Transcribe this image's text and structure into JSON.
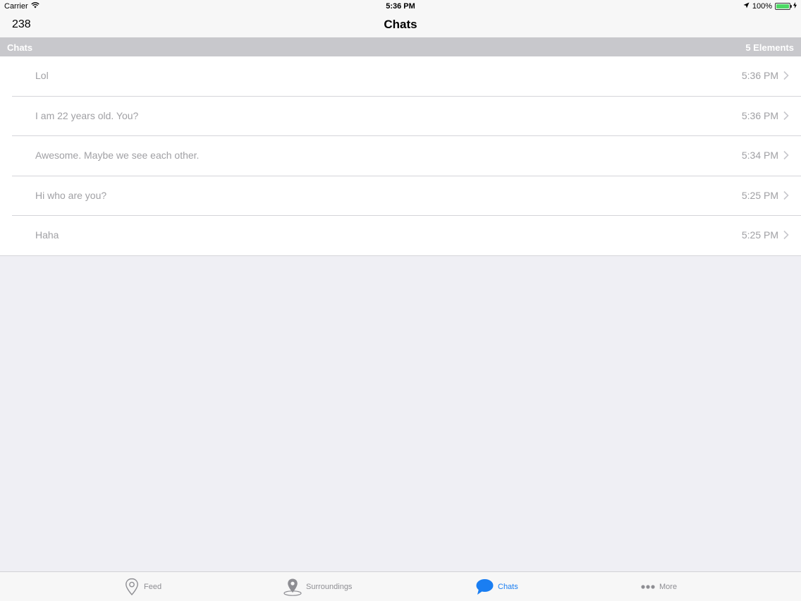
{
  "status_bar": {
    "carrier": "Carrier",
    "time": "5:36 PM",
    "battery": "100%",
    "battery_level": 1.0
  },
  "nav": {
    "count": "238",
    "title": "Chats"
  },
  "section": {
    "title": "Chats",
    "count": "5 Elements"
  },
  "chats": [
    {
      "message": "Lol",
      "time": "5:36 PM"
    },
    {
      "message": "I am 22 years old. You?",
      "time": "5:36 PM"
    },
    {
      "message": "Awesome. Maybe we see each other.",
      "time": "5:34 PM"
    },
    {
      "message": "Hi who are you?",
      "time": "5:25 PM"
    },
    {
      "message": "Haha",
      "time": "5:25 PM"
    }
  ],
  "tabs": [
    {
      "label": "Feed",
      "icon": "pin-outline-icon",
      "active": false
    },
    {
      "label": "Surroundings",
      "icon": "map-pin-icon",
      "active": false
    },
    {
      "label": "Chats",
      "icon": "chat-bubble-icon",
      "active": true
    },
    {
      "label": "More",
      "icon": "more-dots-icon",
      "active": false
    }
  ],
  "colors": {
    "accent": "#1a7ef2",
    "inactive": "#8e8e93",
    "section_header": "#c8c8cc",
    "background": "#efeff4",
    "battery": "#4cd964"
  }
}
